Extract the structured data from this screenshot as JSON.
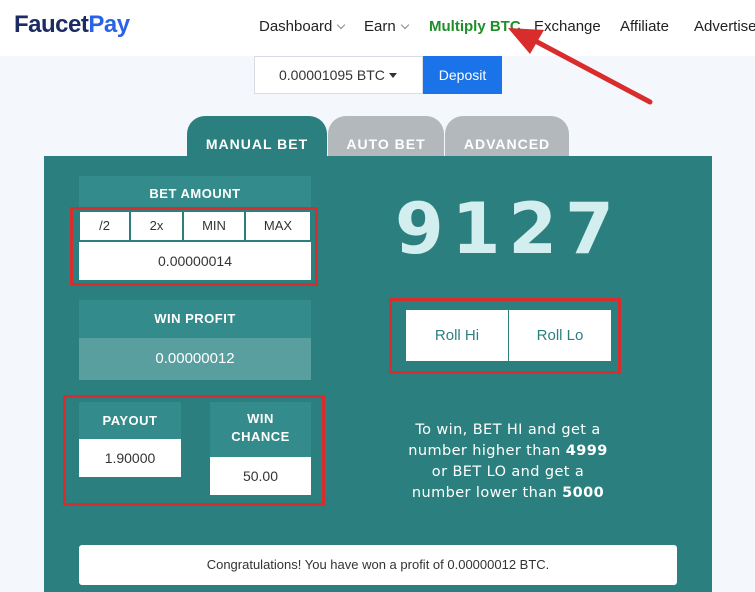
{
  "nav": {
    "logo_part1": "Faucet",
    "logo_part2": "Pay",
    "items": [
      {
        "label": "Dashboard"
      },
      {
        "label": "Earn"
      },
      {
        "label": "Multiply BTC"
      },
      {
        "label": "Exchange"
      },
      {
        "label": "Affiliate"
      },
      {
        "label": "Advertise"
      }
    ]
  },
  "balance": {
    "value": "0.00001095 BTC",
    "deposit_label": "Deposit"
  },
  "tabs": [
    {
      "label": "MANUAL BET",
      "active": true
    },
    {
      "label": "AUTO BET",
      "active": false
    },
    {
      "label": "ADVANCED",
      "active": false
    }
  ],
  "bet": {
    "header": "BET AMOUNT",
    "buttons": [
      "/2",
      "2x",
      "MIN",
      "MAX"
    ],
    "amount": "0.00000014"
  },
  "win_profit": {
    "header": "WIN PROFIT",
    "value": "0.00000012"
  },
  "payout": {
    "header": "PAYOUT",
    "value": "1.90000"
  },
  "win_chance": {
    "header_line1": "WIN",
    "header_line2": "CHANCE",
    "value": "50.00"
  },
  "result": {
    "number": "9127"
  },
  "roll": {
    "hi_label": "Roll Hi",
    "lo_label": "Roll Lo"
  },
  "rules": {
    "line1": "To win, BET HI and get a",
    "line2_prefix": "number higher than ",
    "hi_threshold": "4999",
    "line3": "or BET LO and get a",
    "line4_prefix": "number lower than ",
    "lo_threshold": "5000"
  },
  "message": "Congratulations! You have won a profit of 0.00000012 BTC.",
  "colors": {
    "panel": "#2b7f7f",
    "accent_green": "#1f8f2a",
    "deposit_blue": "#1a73e8",
    "highlight_red": "#d92c2c"
  }
}
